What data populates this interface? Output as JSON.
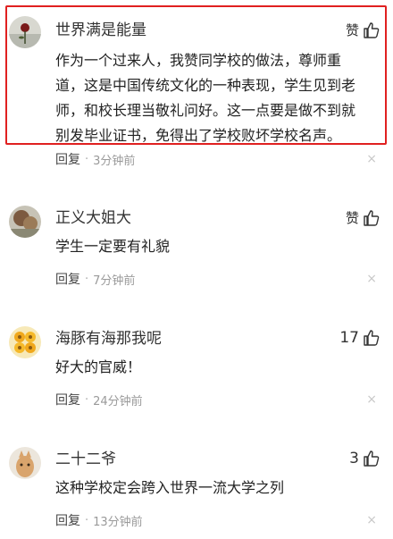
{
  "comments": [
    {
      "name": "世界满是能量",
      "like_label": "赞",
      "like_count": "",
      "lines": [
        "作为一个过来人，我赞同学校的做法，尊师重",
        "道，这是中国传统文化的一种表现，学生见到老",
        "师，和校长理当敬礼问好。这一点要是做不到就",
        "别发毕业证书，免得出了学校败坏学校名声。"
      ],
      "reply": "回复",
      "time": "3分钟前",
      "close": "×"
    },
    {
      "name": "正义大姐大",
      "like_label": "赞",
      "like_count": "",
      "lines": [
        "学生一定要有礼貌"
      ],
      "reply": "回复",
      "time": "7分钟前",
      "close": "×"
    },
    {
      "name": "海豚有海那我呢",
      "like_label": "",
      "like_count": "17",
      "lines": [
        "好大的官威！"
      ],
      "reply": "回复",
      "time": "24分钟前",
      "close": "×"
    },
    {
      "name": "二十二爷",
      "like_label": "",
      "like_count": "3",
      "lines": [
        "这种学校定会跨入世界一流大学之列"
      ],
      "reply": "回复",
      "time": "13分钟前",
      "close": "×"
    }
  ],
  "separator": "·",
  "colors": {
    "highlight": "#e02020",
    "meta": "#9a9a9a"
  },
  "icons": {
    "like": "thumbs-up-icon",
    "close": "close-icon"
  }
}
